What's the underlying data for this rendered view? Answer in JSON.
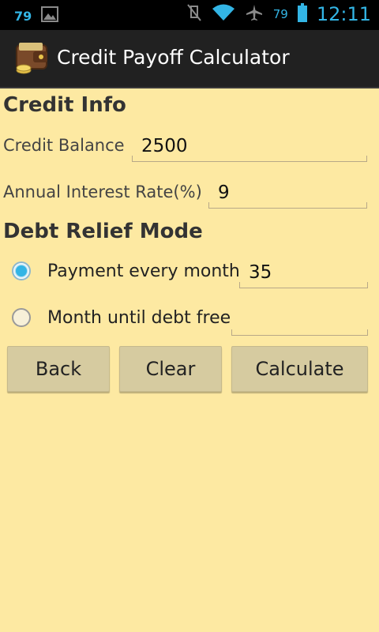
{
  "status_bar": {
    "notification_count": "79",
    "battery_level": "79",
    "time": "12:11"
  },
  "app": {
    "title": "Credit Payoff Calculator"
  },
  "credit_info": {
    "heading": "Credit Info",
    "balance_label": "Credit Balance",
    "balance_value": "2500",
    "rate_label": "Annual Interest Rate(%)",
    "rate_value": "9"
  },
  "debt_relief": {
    "heading": "Debt Relief Mode",
    "options": [
      {
        "label": "Payment every month",
        "value": "35",
        "selected": true
      },
      {
        "label": "Month until debt free",
        "value": "",
        "selected": false
      }
    ]
  },
  "buttons": {
    "back": "Back",
    "clear": "Clear",
    "calculate": "Calculate"
  },
  "colors": {
    "background": "#fde9a2",
    "accent": "#33b5e5",
    "button": "#d6cba0",
    "action_bar": "#212121"
  },
  "icons": [
    "image-icon",
    "mute-icon",
    "wifi-icon",
    "airplane-icon",
    "battery-icon",
    "wallet-icon"
  ]
}
